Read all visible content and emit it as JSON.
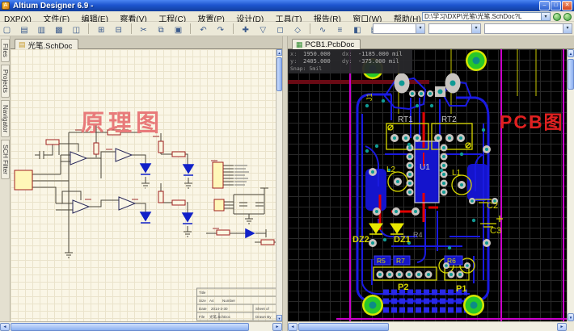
{
  "window": {
    "title": "Altium Designer 6.9 -",
    "icon_glyph": "A",
    "minimize": "–",
    "maximize": "□",
    "close": "✕"
  },
  "menu": {
    "items": [
      "DXP(X)",
      "文件(F)",
      "编辑(E)",
      "察看(V)",
      "工程(C)",
      "放置(P)",
      "设计(D)",
      "工具(T)",
      "报告(R)",
      "窗口(W)",
      "帮助(H)"
    ]
  },
  "address": {
    "path": "D:\\学习\\DXP\\光笔\\光笔.SchDoc?L",
    "dropdown": "▾"
  },
  "toolbar": {
    "icons": [
      {
        "name": "new-document-icon",
        "glyph": "▢"
      },
      {
        "name": "open-icon",
        "glyph": "▤"
      },
      {
        "name": "save-icon",
        "glyph": "▥"
      },
      {
        "name": "print-icon",
        "glyph": "▩"
      },
      {
        "name": "print-preview-icon",
        "glyph": "◫"
      },
      {
        "name": "zoom-window-icon",
        "glyph": "⊞"
      },
      {
        "name": "zoom-fit-icon",
        "glyph": "⊟"
      },
      {
        "name": "cut-icon",
        "glyph": "✂"
      },
      {
        "name": "copy-icon",
        "glyph": "⧉"
      },
      {
        "name": "paste-icon",
        "glyph": "▣"
      },
      {
        "name": "undo-icon",
        "glyph": "↶"
      },
      {
        "name": "redo-icon",
        "glyph": "↷"
      },
      {
        "name": "cross-probe-icon",
        "glyph": "✚"
      },
      {
        "name": "filter-icon",
        "glyph": "▽"
      },
      {
        "name": "select-icon",
        "glyph": "◻"
      },
      {
        "name": "move-icon",
        "glyph": "◇"
      },
      {
        "name": "wire-icon",
        "glyph": "∿"
      },
      {
        "name": "bus-icon",
        "glyph": "≡"
      },
      {
        "name": "part-icon",
        "glyph": "◧"
      },
      {
        "name": "library-icon",
        "glyph": "▦"
      }
    ],
    "combos": [
      "",
      "",
      ""
    ],
    "combo_arrow": "▾"
  },
  "panels": {
    "rail": [
      "Files",
      "Projects",
      "Navigator",
      "SCH Filter"
    ]
  },
  "scrollbar": {
    "left": "◄",
    "right": "►",
    "up": "▲",
    "down": "▼"
  },
  "sch": {
    "tab": "光笔.SchDoc",
    "tab_icon": "▤",
    "overlay": "原理图",
    "title_block": {
      "title": "Title",
      "size": "Size",
      "size_value": "A4",
      "number": "Number",
      "date": "Date",
      "date_value": "2014-3-30",
      "file": "File",
      "file_value": "光笔.SchDoc",
      "sheet": "Sheet of",
      "drawn": "Drawn By"
    }
  },
  "pcb": {
    "tab": "PCB1.PcbDoc",
    "tab_icon": "▦",
    "overlay": "PCB图",
    "hud": {
      "x_label": "x:",
      "x": "1950.000",
      "dx_label": "dx:",
      "dx": "-1185.000 mil",
      "y_label": "y:",
      "y": "2405.000",
      "dy_label": "dy:",
      "dy": "-375.000 mil",
      "snap": "Snap: 5mil"
    },
    "labels": {
      "j1": "J1",
      "rt1": "RT1",
      "rt2": "RT2",
      "u1": "U1",
      "l1": "L1",
      "l2": "L2",
      "dz1": "DZ1",
      "dz2": "DZ2",
      "c2": "C2",
      "c3": "C3",
      "r4": "R4",
      "r5": "R5",
      "r6": "R6",
      "r7": "R7",
      "p1": "P1",
      "p2": "P2"
    }
  },
  "colors": {
    "trace_blue": "#1a1ae0",
    "pad_gray": "#c8c4c0",
    "hole_teal": "#0f9a94",
    "silk_yellow": "#d8d800",
    "keepout_magenta": "#cc00cc",
    "pcb_overlay_red": "#e02020",
    "sch_overlay_red": "#e87a7a"
  }
}
